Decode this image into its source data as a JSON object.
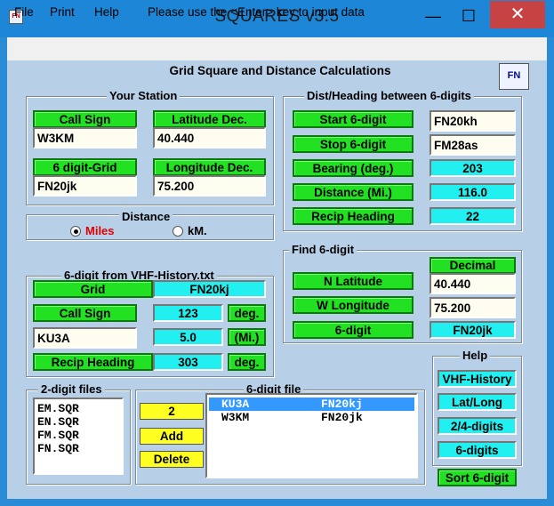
{
  "window": {
    "title": "SQUARES  v3.5",
    "minimize": "—",
    "maximize": "☐",
    "close": "✕",
    "icon": "FN"
  },
  "menu": {
    "file": "File",
    "print": "Print",
    "help": "Help",
    "hint": "Please use the <Enter> key to input data"
  },
  "heading": "Grid Square and Distance Calculations",
  "corner_icon": "FN",
  "your_station": {
    "title": "Your Station",
    "call_sign_label": "Call Sign",
    "call_sign": "W3KM",
    "lat_label": "Latitude Dec.",
    "lat": "40.440",
    "grid_label": "6 digit-Grid",
    "grid": "FN20jk",
    "lon_label": "Longitude Dec.",
    "lon": "75.200"
  },
  "distance": {
    "title": "Distance",
    "miles": "Miles",
    "km": "kM.",
    "selected": "Miles"
  },
  "vhf": {
    "title": "6-digit from VHF-History.txt",
    "grid_label": "Grid",
    "grid": "FN20kj",
    "call_sign_label": "Call Sign",
    "bearing": "123",
    "bearing_unit": "deg.",
    "call": "KU3A",
    "dist": "5.0",
    "dist_unit": "(Mi.)",
    "recip_label": "Recip Heading",
    "recip": "303",
    "recip_unit": "deg."
  },
  "dist_heading": {
    "title": "Dist/Heading between 6-digits",
    "start_label": "Start  6-digit",
    "start": "FN20kh",
    "stop_label": "Stop  6-digit",
    "stop": "FM28as",
    "bearing_label": "Bearing  (deg.)",
    "bearing": "203",
    "distance_label": "Distance (Mi.)",
    "distance": "116.0",
    "recip_label": "Recip Heading",
    "recip": "22"
  },
  "find": {
    "title": "Find 6-digit",
    "decimal_label": "Decimal",
    "nlat_label": "N Latitude",
    "nlat": "40.440",
    "wlon_label": "W Longitude",
    "wlon": "75.200",
    "digit_label": "6-digit",
    "digit": "FN20jk"
  },
  "help": {
    "title": "Help",
    "vhf": "VHF-History",
    "latlong": "Lat/Long",
    "two_four": "2/4-digits",
    "six": "6-digits"
  },
  "sort_button": "Sort 6-digit",
  "two_digit": {
    "title": "2-digit files",
    "items": [
      "EM.SQR",
      "EN.SQR",
      "FM.SQR",
      "FN.SQR"
    ]
  },
  "six_digit": {
    "title": "6-digit file",
    "count": "2",
    "add": "Add",
    "delete": "Delete",
    "rows": [
      {
        "call": "KU3A",
        "grid": "FN20kj",
        "selected": true
      },
      {
        "call": "W3KM",
        "grid": "FN20jk",
        "selected": false
      }
    ]
  },
  "colors": {
    "green": "#22e022",
    "cyan": "#22f0f0",
    "yellow": "#ffff22",
    "field": "#fffdf0",
    "background": "#b8cfe8",
    "titlebar": "#1e86d6",
    "close": "#c74343"
  }
}
